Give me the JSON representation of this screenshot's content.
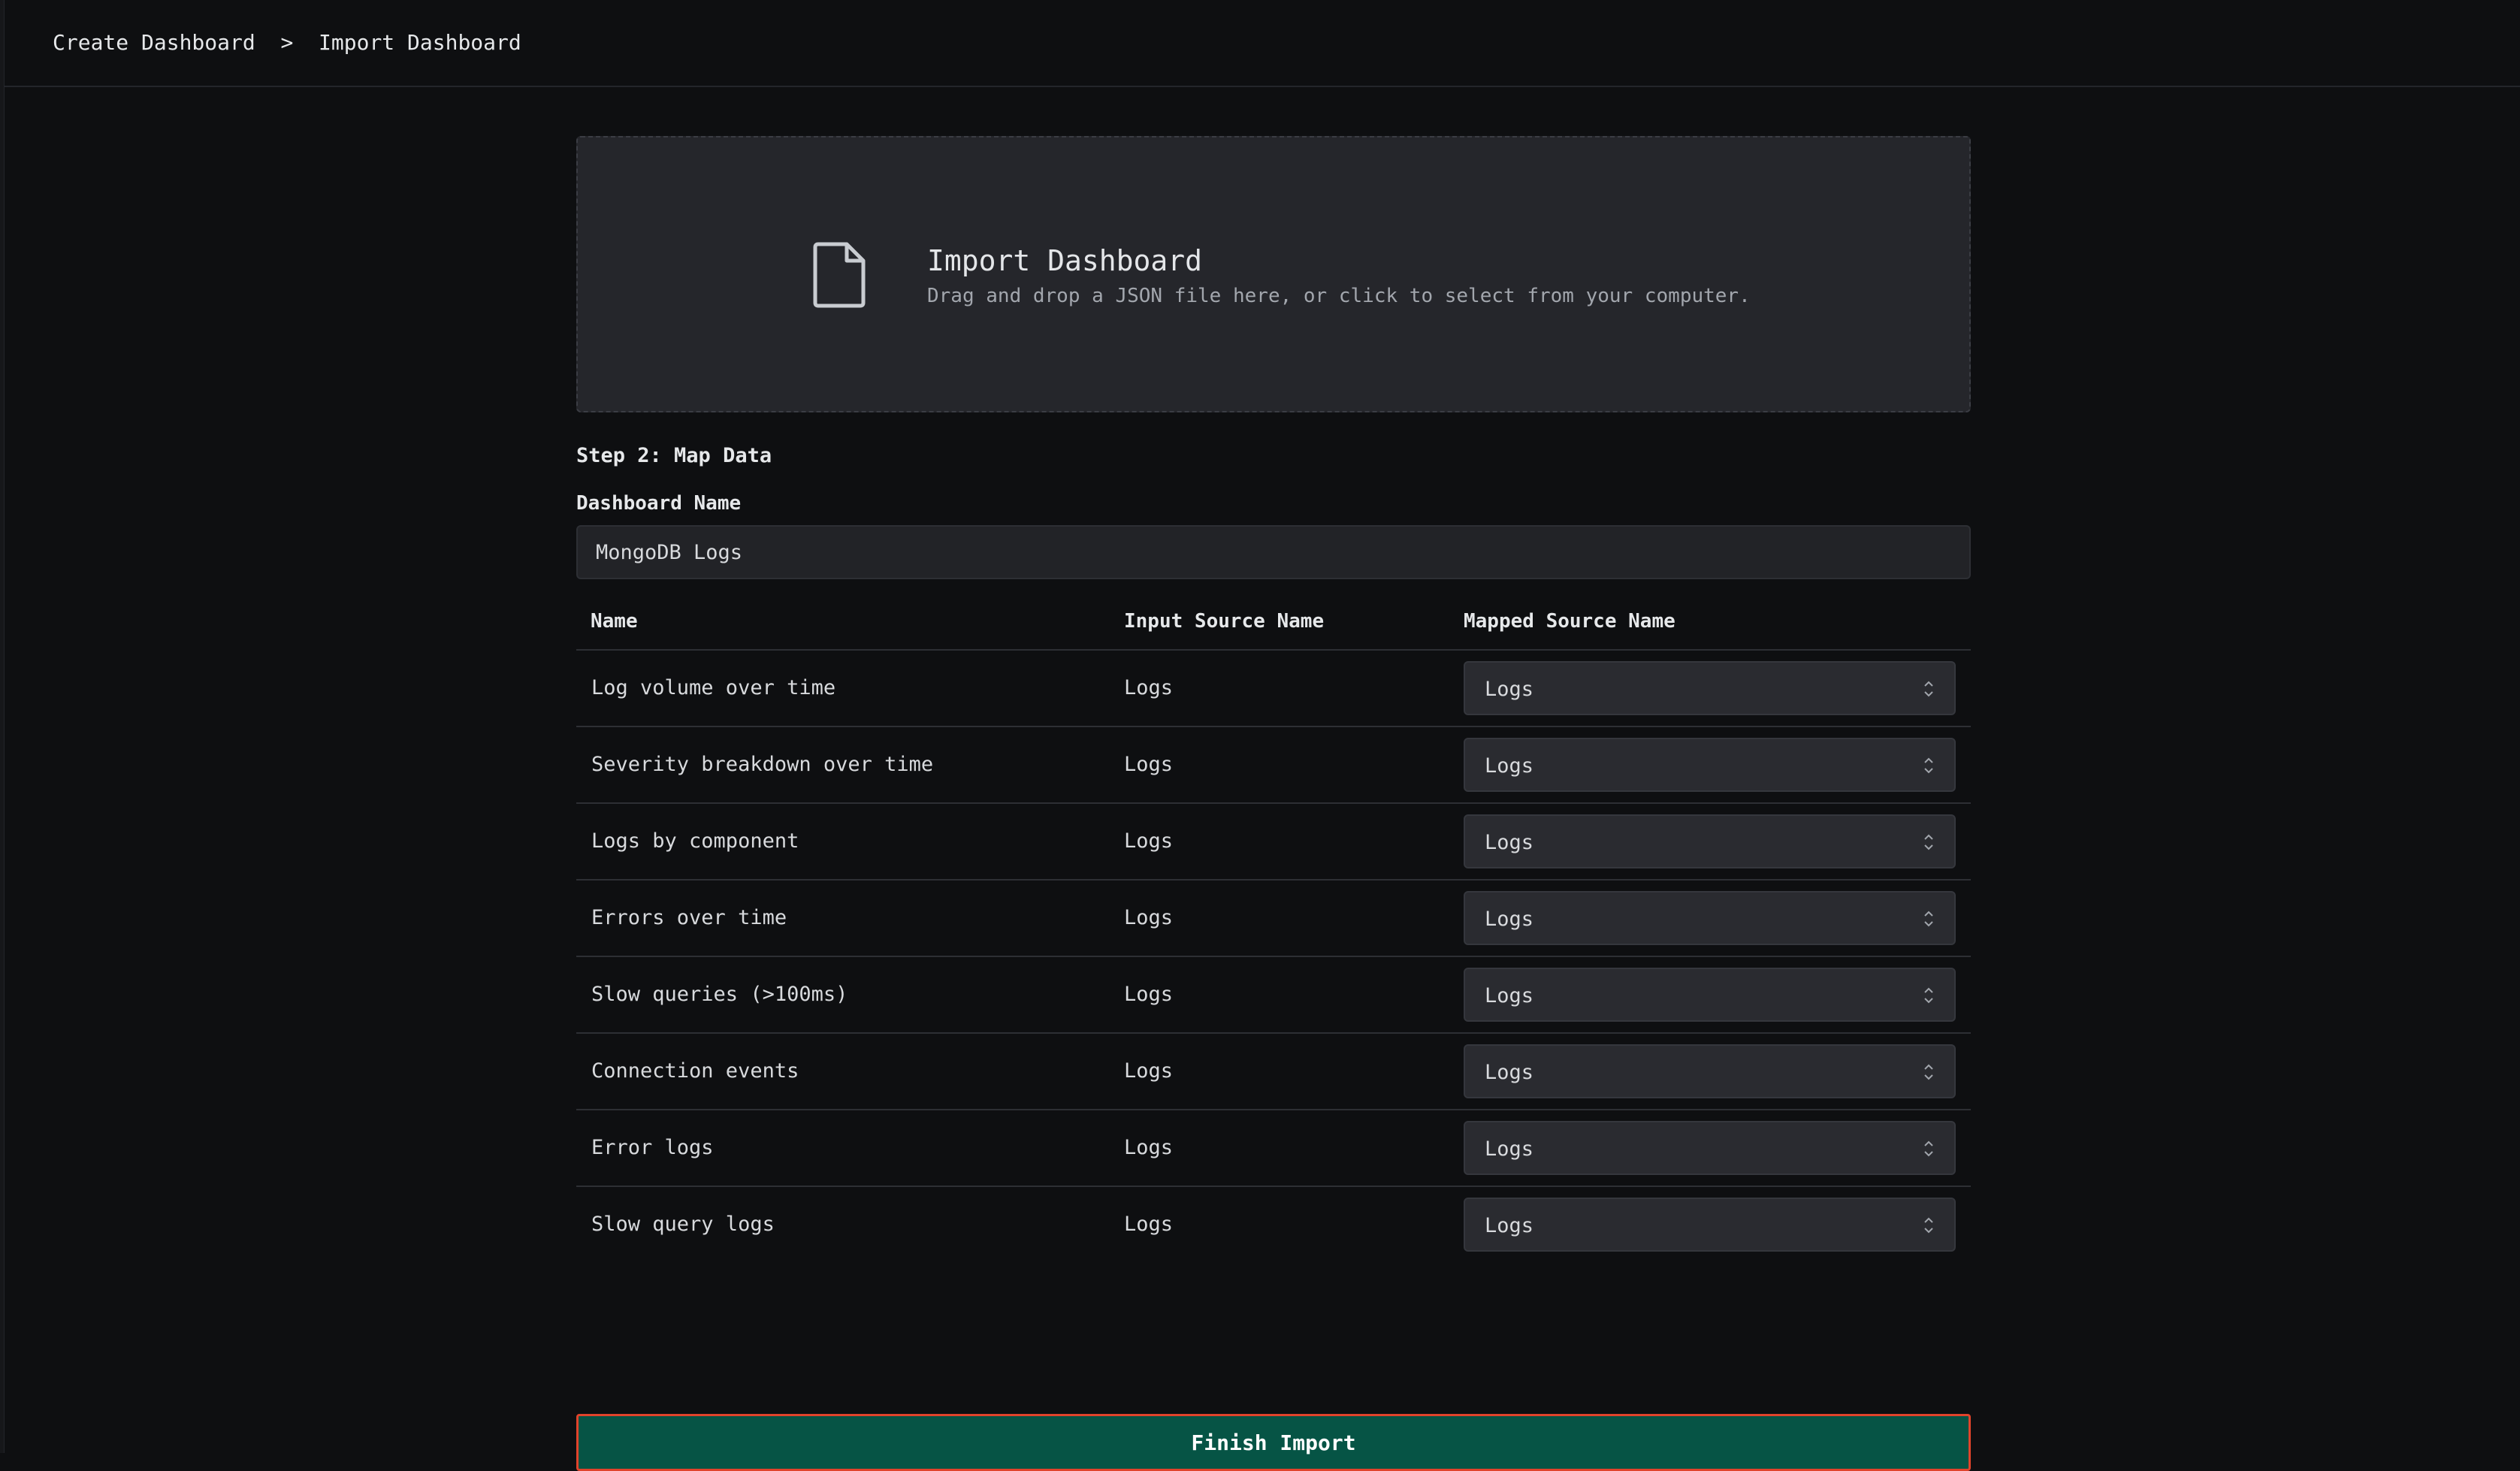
{
  "breadcrumb": {
    "parent": "Create Dashboard",
    "separator": ">",
    "current": "Import Dashboard"
  },
  "dropzone": {
    "title": "Import Dashboard",
    "subtitle": "Drag and drop a JSON file here, or click to select from your computer.",
    "icon": "file-icon"
  },
  "step": {
    "label": "Step 2: Map Data"
  },
  "dashboard_name": {
    "label": "Dashboard Name",
    "value": "MongoDB Logs"
  },
  "table": {
    "headers": {
      "name": "Name",
      "input_source": "Input Source Name",
      "mapped_source": "Mapped Source Name"
    },
    "rows": [
      {
        "name": "Log volume over time",
        "input_source": "Logs",
        "mapped_source": "Logs"
      },
      {
        "name": "Severity breakdown over time",
        "input_source": "Logs",
        "mapped_source": "Logs"
      },
      {
        "name": "Logs by component",
        "input_source": "Logs",
        "mapped_source": "Logs"
      },
      {
        "name": "Errors over time",
        "input_source": "Logs",
        "mapped_source": "Logs"
      },
      {
        "name": "Slow queries (>100ms)",
        "input_source": "Logs",
        "mapped_source": "Logs"
      },
      {
        "name": "Connection events",
        "input_source": "Logs",
        "mapped_source": "Logs"
      },
      {
        "name": "Error logs",
        "input_source": "Logs",
        "mapped_source": "Logs"
      },
      {
        "name": "Slow query logs",
        "input_source": "Logs",
        "mapped_source": "Logs"
      }
    ]
  },
  "finish_button": {
    "label": "Finish Import"
  },
  "colors": {
    "background": "#0e0f11",
    "dropzone": "#25262b",
    "finish_button": "#065445",
    "focus_ring": "#e0432b"
  }
}
